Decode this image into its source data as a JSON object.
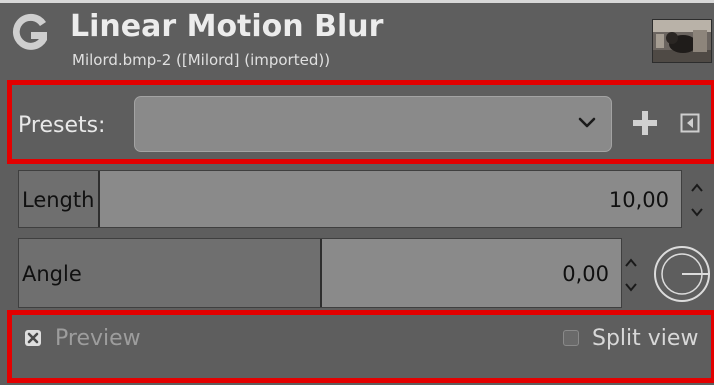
{
  "dialog": {
    "title": "Linear Motion Blur",
    "subtitle": "Milord.bmp-2 ([Milord] (imported))"
  },
  "presets": {
    "label": "Presets:",
    "value": ""
  },
  "length": {
    "label": "Length",
    "value": "10,00",
    "fill_fraction": 0.12
  },
  "angle": {
    "label": "Angle",
    "value": "0,00",
    "fill_fraction": 0.5
  },
  "preview": {
    "label": "Preview",
    "checked": true
  },
  "split_view": {
    "label": "Split view",
    "checked": false
  },
  "icons": {
    "app": "gimp-icon",
    "presets_dropdown": "chevron-down-icon",
    "add_preset": "plus-icon",
    "presets_menu": "menu-icon",
    "spin": "spin-up-down-icon",
    "angle_dial": "dial-icon"
  },
  "colors": {
    "background": "#5e5e5e",
    "highlight": "#e30000",
    "widget": "#8a8a8a",
    "text": "#101010"
  }
}
